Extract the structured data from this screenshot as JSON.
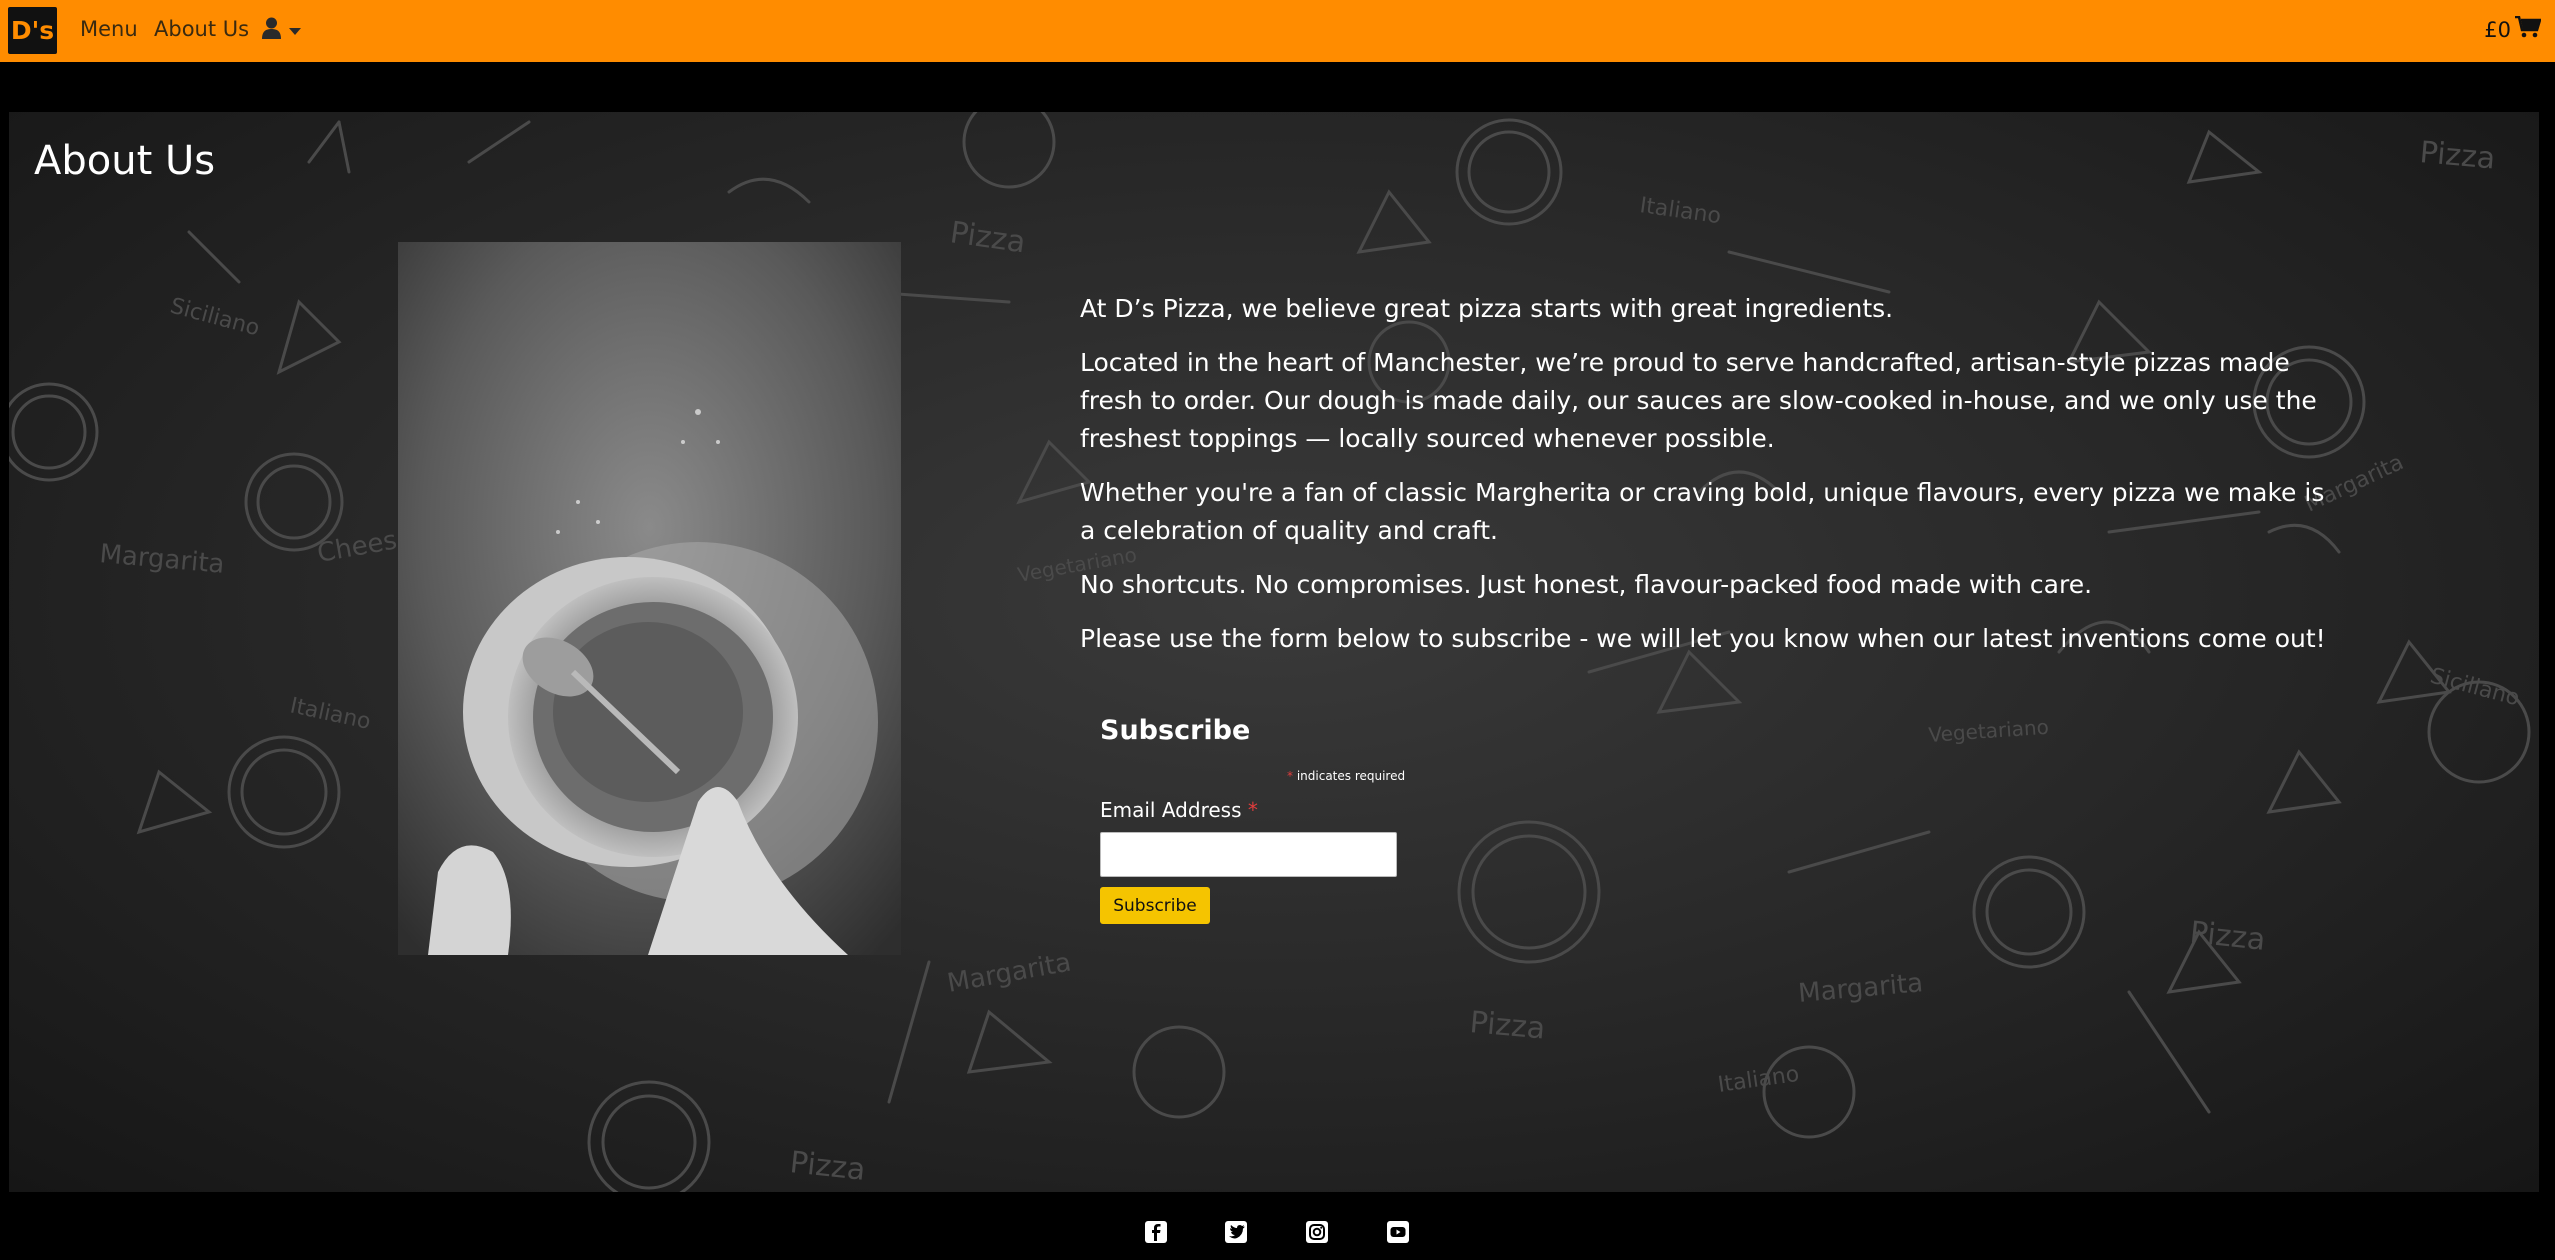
{
  "nav": {
    "logo_text": "D's",
    "menu_label": "Menu",
    "about_label": "About Us",
    "cart_total": "£0",
    "icons": [
      "user-icon",
      "caret-down-icon",
      "cart-icon"
    ]
  },
  "page": {
    "title": "About Us",
    "paragraphs": [
      "At D’s Pizza, we believe great pizza starts with great ingredients.",
      "Located in the heart of Manchester, we’re proud to serve handcrafted, artisan-style pizzas made fresh to order. Our dough is made daily, our sauces are slow-cooked in-house, and we only use the freshest toppings — locally sourced whenever possible.",
      "Whether you're a fan of classic Margherita or craving bold, unique flavours, every pizza we make is a celebration of quality and craft.",
      "No shortcuts. No compromises. Just honest, flavour-packed food made with care.",
      "Please use the form below to subscribe - we will let you know when our latest inventions come out!"
    ]
  },
  "subscribe": {
    "title": "Subscribe",
    "required_asterisk": "*",
    "required_note": "indicates required",
    "email_label": "Email Address",
    "email_value": "",
    "button_label": "Subscribe"
  },
  "background_words": [
    "Pizza",
    "Italiano",
    "Siciliano",
    "Margarita",
    "Vegetariano",
    "Cheese"
  ],
  "footer": {
    "social_icons": [
      "facebook-icon",
      "twitter-icon",
      "instagram-icon",
      "youtube-icon"
    ]
  },
  "colors": {
    "navbar": "#ff8c00",
    "subscribe_button": "#f5c400",
    "required": "#e03c3c"
  }
}
